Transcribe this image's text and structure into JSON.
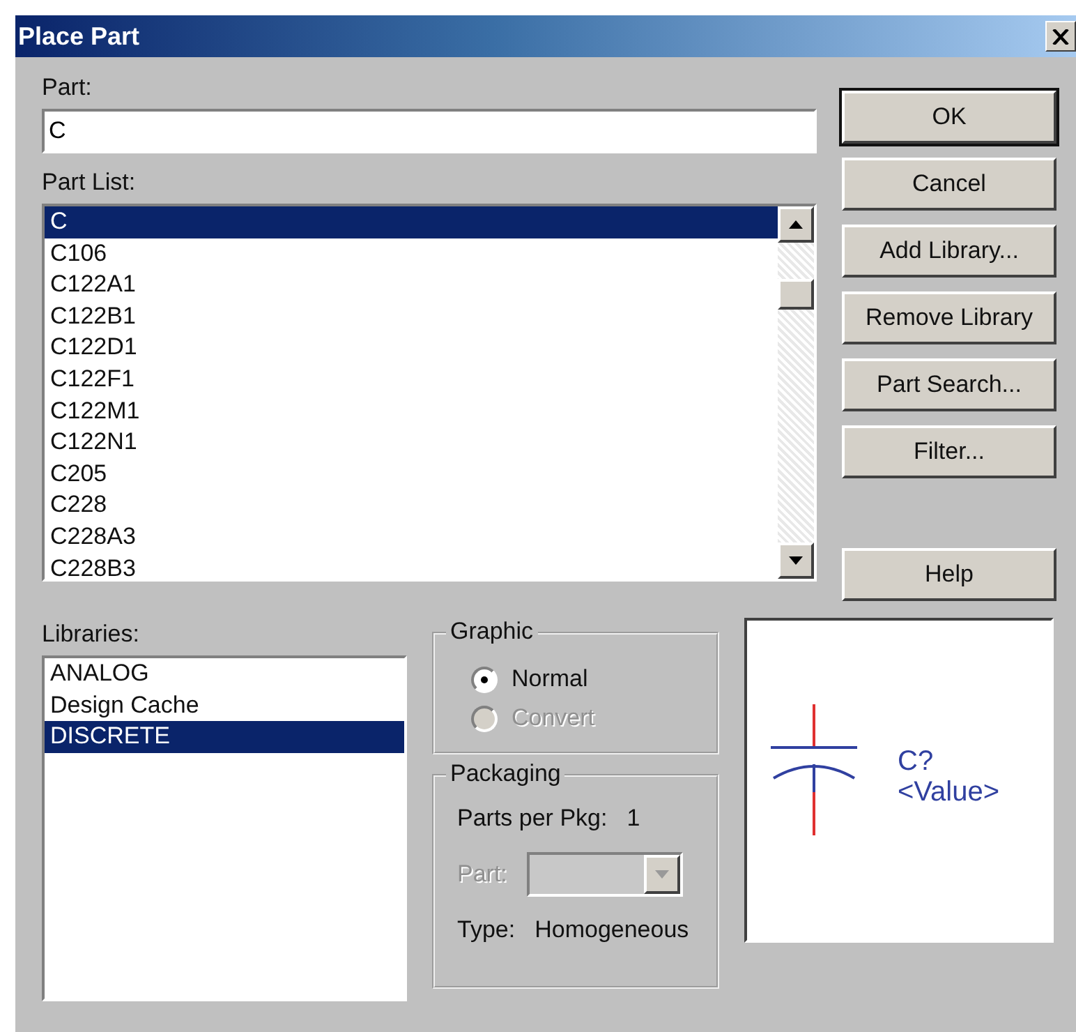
{
  "window": {
    "title": "Place Part"
  },
  "part": {
    "label": "Part:",
    "value": "C"
  },
  "part_list": {
    "label": "Part List:",
    "items": [
      {
        "text": "C",
        "selected": true
      },
      {
        "text": "C106",
        "selected": false
      },
      {
        "text": "C122A1",
        "selected": false
      },
      {
        "text": "C122B1",
        "selected": false
      },
      {
        "text": "C122D1",
        "selected": false
      },
      {
        "text": "C122F1",
        "selected": false
      },
      {
        "text": "C122M1",
        "selected": false
      },
      {
        "text": "C122N1",
        "selected": false
      },
      {
        "text": "C205",
        "selected": false
      },
      {
        "text": "C228",
        "selected": false
      },
      {
        "text": "C228A3",
        "selected": false
      },
      {
        "text": "C228B3",
        "selected": false
      }
    ]
  },
  "buttons": [
    {
      "label": "OK",
      "default": true
    },
    {
      "label": "Cancel",
      "default": false
    },
    {
      "label": "Add Library...",
      "default": false
    },
    {
      "label": "Remove Library",
      "default": false
    },
    {
      "label": "Part Search...",
      "default": false
    },
    {
      "label": "Filter...",
      "default": false
    }
  ],
  "help_button": {
    "label": "Help"
  },
  "libraries": {
    "label": "Libraries:",
    "items": [
      {
        "text": "ANALOG",
        "selected": false
      },
      {
        "text": "Design Cache",
        "selected": false
      },
      {
        "text": "DISCRETE",
        "selected": true
      }
    ]
  },
  "graphic": {
    "label": "Graphic",
    "options": [
      {
        "label": "Normal",
        "selected": true,
        "disabled": false
      },
      {
        "label": "Convert",
        "selected": false,
        "disabled": true
      }
    ]
  },
  "packaging": {
    "label": "Packaging",
    "parts_per_pkg_label": "Parts per Pkg:",
    "parts_per_pkg": "1",
    "part_label": "Part:",
    "part_disabled": true,
    "type_label": "Type:",
    "type": "Homogeneous"
  },
  "preview": {
    "reference": "C?",
    "value": "<Value>"
  }
}
